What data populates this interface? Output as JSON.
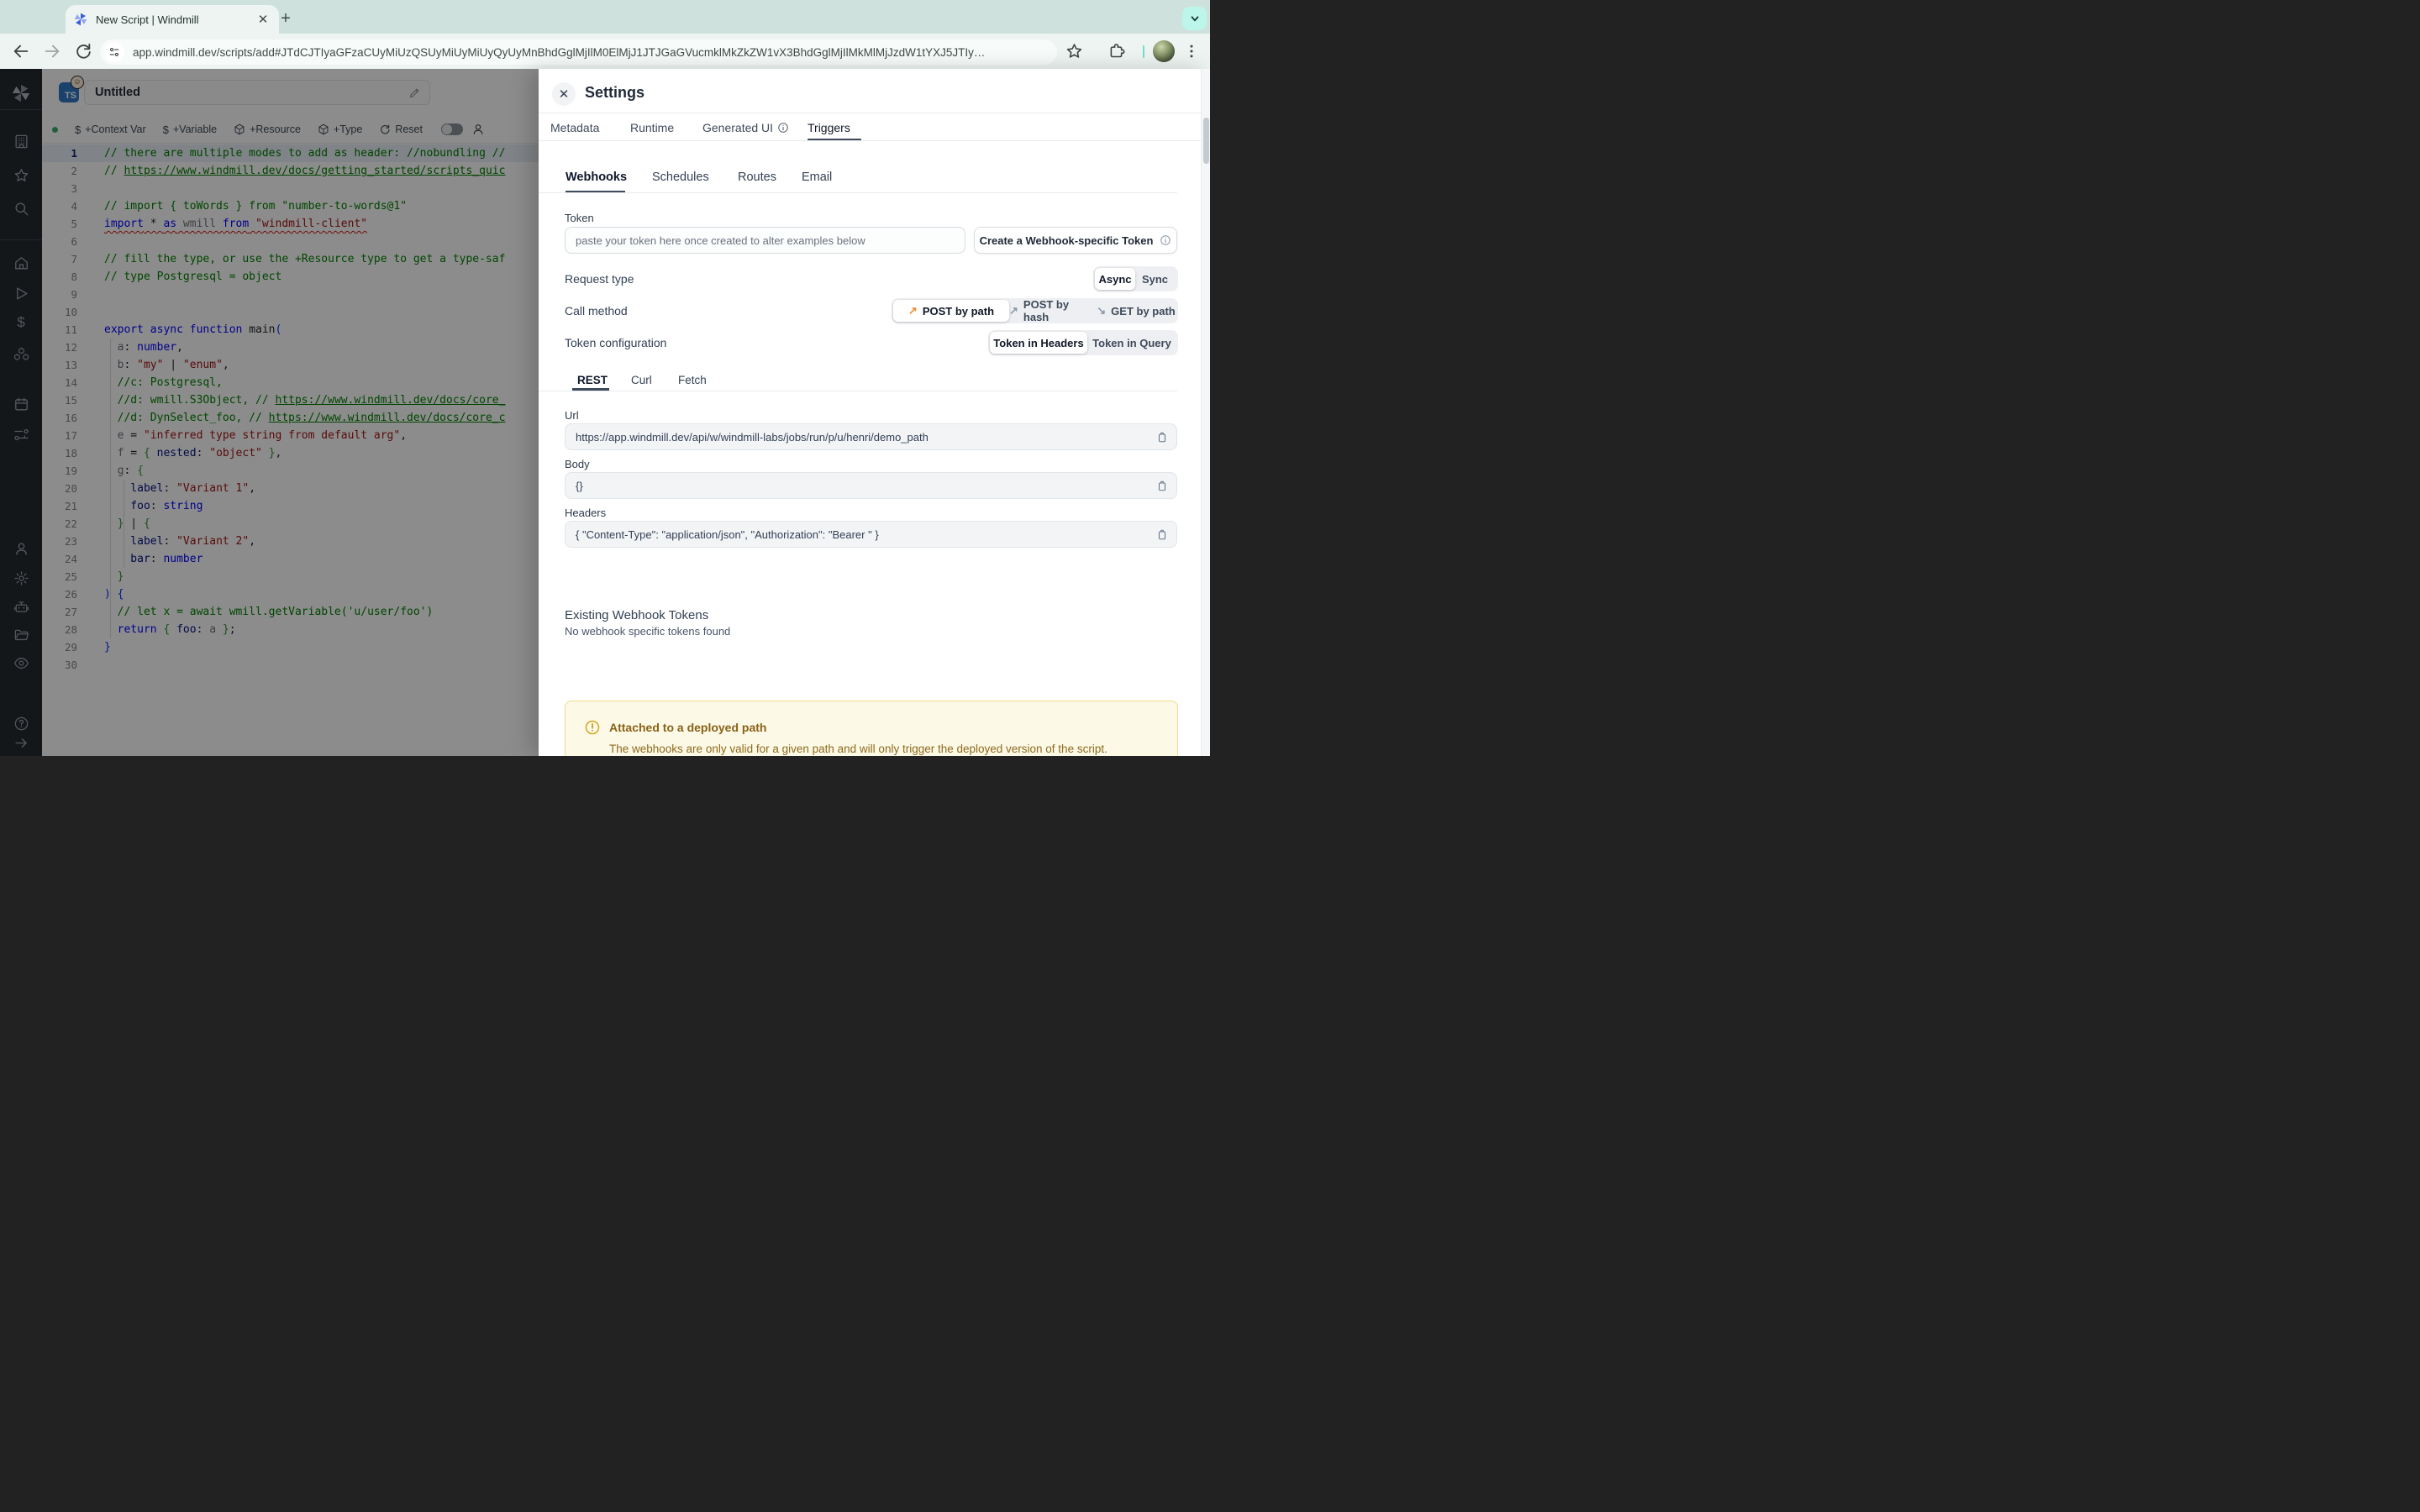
{
  "colors": {
    "chrome_bg": "#cfe1dc",
    "chrome_surface": "#eef4f1",
    "accent_mint": "#bcf6ea",
    "brand_blue": "#3178c6",
    "selected_arrow_orange": "#f08c2e",
    "warning_bg": "#fcf9e7",
    "warning_text": "#8a6117",
    "drawer_bg": "#ffffff"
  },
  "browser": {
    "tab_title": "New Script | Windmill",
    "new_tab_label": "+",
    "url": "app.windmill.dev/scripts/add#JTdCJTIyaGFzaCUyMiUzQSUyMiUyMiUyQyUyMnBhdGglMjIlM0ElMjJ1JTJGaGVucmklMkZkZW1vX3BhdGglMjIlMkMlMjJzdW1tYXJ5JTIy…",
    "icons": [
      "windmill-favicon",
      "tab-close",
      "new-tab",
      "tab-search-chevron",
      "back",
      "forward",
      "reload",
      "tune",
      "bookmark-star",
      "extensions",
      "profile-avatar",
      "kebab-menu"
    ]
  },
  "sidebar": {
    "icons": [
      "windmill-logo",
      "workspace-building",
      "favorites-star",
      "search",
      "home",
      "runs-play",
      "variables-dollar",
      "resources-cubes",
      "schedules-calendar",
      "routes",
      "users-person",
      "settings-gear",
      "workers-robot",
      "folders",
      "audit-eye",
      "help-question",
      "collapse-arrow"
    ]
  },
  "editor": {
    "language_badge": "TS",
    "title": "Untitled",
    "toolbar": {
      "context_var": "+Context Var",
      "variable": "+Variable",
      "resource": "+Resource",
      "type": "+Type",
      "reset": "Reset"
    },
    "code": {
      "lines": [
        {
          "n": 1,
          "hl": true,
          "tokens": [
            [
              "c",
              "// there are multiple modes to add as header: //nobundling //"
            ]
          ]
        },
        {
          "n": 2,
          "tokens": [
            [
              "c",
              "// "
            ],
            [
              "cl",
              "https://www.windmill.dev/docs/getting_started/scripts_quic"
            ]
          ]
        },
        {
          "n": 3,
          "tokens": []
        },
        {
          "n": 4,
          "tokens": [
            [
              "c",
              "// import { toWords } from \"number-to-words@1\""
            ]
          ]
        },
        {
          "n": 5,
          "squiggle": true,
          "tokens": [
            [
              "k",
              "import"
            ],
            [
              "p",
              " * "
            ],
            [
              "k",
              "as"
            ],
            [
              "g",
              " wmill "
            ],
            [
              "k",
              "from"
            ],
            [
              "s",
              " \"windmill-client\""
            ]
          ]
        },
        {
          "n": 6,
          "tokens": []
        },
        {
          "n": 7,
          "tokens": [
            [
              "c",
              "// fill the type, or use the +Resource type to get a type-saf"
            ]
          ]
        },
        {
          "n": 8,
          "tokens": [
            [
              "c",
              "// type Postgresql = object"
            ]
          ]
        },
        {
          "n": 9,
          "tokens": []
        },
        {
          "n": 10,
          "tokens": []
        },
        {
          "n": 11,
          "tokens": [
            [
              "k",
              "export async function "
            ],
            [
              "p",
              "main"
            ],
            [
              "b2",
              "("
            ]
          ]
        },
        {
          "n": 12,
          "tokens": [
            [
              "g",
              "  a"
            ],
            [
              "p",
              ": "
            ],
            [
              "k",
              "number"
            ],
            [
              "p",
              ","
            ]
          ]
        },
        {
          "n": 13,
          "tokens": [
            [
              "g",
              "  b"
            ],
            [
              "p",
              ": "
            ],
            [
              "s",
              "\"my\""
            ],
            [
              "p",
              " | "
            ],
            [
              "s",
              "\"enum\""
            ],
            [
              "p",
              ","
            ]
          ]
        },
        {
          "n": 14,
          "tokens": [
            [
              "c",
              "  //c: Postgresql,"
            ]
          ]
        },
        {
          "n": 15,
          "tokens": [
            [
              "c",
              "  //d: wmill.S3Object, // "
            ],
            [
              "cl",
              "https://www.windmill.dev/docs/core_"
            ]
          ]
        },
        {
          "n": 16,
          "tokens": [
            [
              "c",
              "  //d: DynSelect_foo, // "
            ],
            [
              "cl",
              "https://www.windmill.dev/docs/core_c"
            ]
          ]
        },
        {
          "n": 17,
          "tokens": [
            [
              "g",
              "  e"
            ],
            [
              "p",
              " = "
            ],
            [
              "s",
              "\"inferred type string from default arg\""
            ],
            [
              "p",
              ","
            ]
          ]
        },
        {
          "n": 18,
          "tokens": [
            [
              "g",
              "  f"
            ],
            [
              "p",
              " = "
            ],
            [
              "b1",
              "{ "
            ],
            [
              "n2",
              "nested"
            ],
            [
              "p",
              ": "
            ],
            [
              "s",
              "\"object\""
            ],
            [
              "b1",
              " }"
            ],
            [
              "p",
              ","
            ]
          ]
        },
        {
          "n": 19,
          "tokens": [
            [
              "g",
              "  g"
            ],
            [
              "p",
              ": "
            ],
            [
              "b1",
              "{"
            ]
          ]
        },
        {
          "n": 20,
          "tokens": [
            [
              "n2",
              "    label"
            ],
            [
              "p",
              ": "
            ],
            [
              "s",
              "\"Variant 1\""
            ],
            [
              "p",
              ","
            ]
          ]
        },
        {
          "n": 21,
          "tokens": [
            [
              "n2",
              "    foo"
            ],
            [
              "p",
              ": "
            ],
            [
              "k",
              "string"
            ]
          ]
        },
        {
          "n": 22,
          "tokens": [
            [
              "b1",
              "  }"
            ],
            [
              "p",
              " | "
            ],
            [
              "b1",
              "{"
            ]
          ]
        },
        {
          "n": 23,
          "tokens": [
            [
              "n2",
              "    label"
            ],
            [
              "p",
              ": "
            ],
            [
              "s",
              "\"Variant 2\""
            ],
            [
              "p",
              ","
            ]
          ]
        },
        {
          "n": 24,
          "tokens": [
            [
              "n2",
              "    bar"
            ],
            [
              "p",
              ": "
            ],
            [
              "k",
              "number"
            ]
          ]
        },
        {
          "n": 25,
          "tokens": [
            [
              "b1",
              "  }"
            ]
          ]
        },
        {
          "n": 26,
          "tokens": [
            [
              "b2",
              ") {"
            ]
          ]
        },
        {
          "n": 27,
          "tokens": [
            [
              "c",
              "  // let x = await wmill.getVariable('u/user/foo')"
            ]
          ]
        },
        {
          "n": 28,
          "tokens": [
            [
              "p",
              "  "
            ],
            [
              "k",
              "return"
            ],
            [
              "p",
              " "
            ],
            [
              "b1",
              "{ "
            ],
            [
              "n2",
              "foo"
            ],
            [
              "p",
              ": "
            ],
            [
              "g",
              "a"
            ],
            [
              "b1",
              " }"
            ],
            [
              "p",
              ";"
            ]
          ]
        },
        {
          "n": 29,
          "tokens": [
            [
              "b2",
              "}"
            ]
          ]
        },
        {
          "n": 30,
          "tokens": []
        }
      ]
    }
  },
  "settings": {
    "title": "Settings",
    "tabs": [
      {
        "label": "Metadata"
      },
      {
        "label": "Runtime"
      },
      {
        "label": "Generated UI",
        "info": true
      },
      {
        "label": "Triggers",
        "active": true
      }
    ],
    "webhooks": {
      "subtabs": [
        "Webhooks",
        "Schedules",
        "Routes",
        "Email"
      ],
      "token_label": "Token",
      "token_placeholder": "paste your token here once created to alter examples below",
      "create_token_button": "Create a Webhook-specific Token",
      "request_type": {
        "label": "Request type",
        "options": [
          "Async",
          "Sync"
        ],
        "selected": "Async"
      },
      "call_method": {
        "label": "Call method",
        "options": [
          "POST by path",
          "POST by hash",
          "GET by path"
        ],
        "selected": "POST by path",
        "arrows": [
          "↗",
          "↗",
          "↘"
        ]
      },
      "token_config": {
        "label": "Token configuration",
        "options": [
          "Token in Headers",
          "Token in Query"
        ],
        "selected": "Token in Headers"
      },
      "example_tabs": [
        "REST",
        "Curl",
        "Fetch"
      ],
      "url_label": "Url",
      "url_value": "https://app.windmill.dev/api/w/windmill-labs/jobs/run/p/u/henri/demo_path",
      "body_label": "Body",
      "body_value": "{}",
      "headers_label": "Headers",
      "headers_value": "{ \"Content-Type\": \"application/json\", \"Authorization\": \"Bearer \" }",
      "existing_tokens_title": "Existing Webhook Tokens",
      "existing_tokens_empty": "No webhook specific tokens found",
      "alert": {
        "title": "Attached to a deployed path",
        "body": "The webhooks are only valid for a given path and will only trigger the deployed version of the script."
      }
    }
  }
}
